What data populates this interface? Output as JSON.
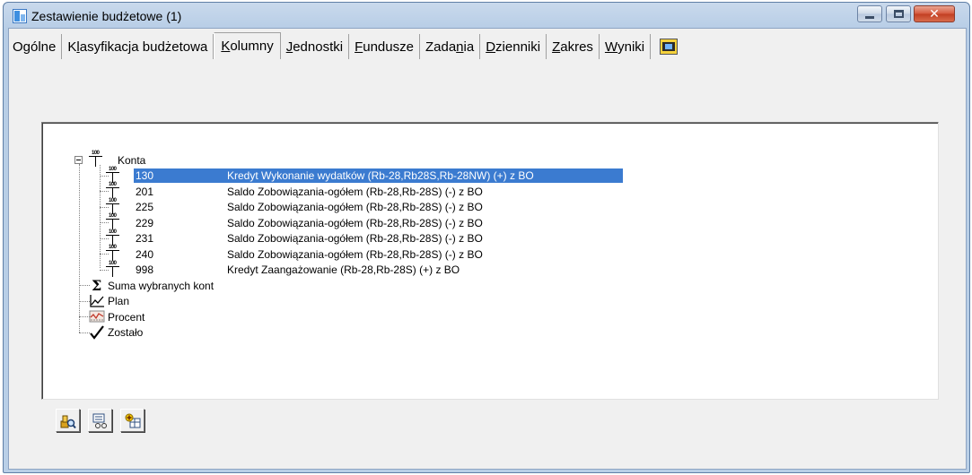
{
  "window": {
    "title": "Zestawienie budżetowe (1)",
    "close_label": "✕"
  },
  "tabs": [
    {
      "label": "Ogólne",
      "underline": ""
    },
    {
      "pre": "K",
      "u": "l",
      "post": "asyfikacja budżetowa"
    },
    {
      "pre": "",
      "u": "K",
      "post": "olumny"
    },
    {
      "pre": "",
      "u": "J",
      "post": "ednostki"
    },
    {
      "pre": "",
      "u": "F",
      "post": "undusze"
    },
    {
      "pre": "Zada",
      "u": "n",
      "post": "ia"
    },
    {
      "pre": "",
      "u": "D",
      "post": "zienniki"
    },
    {
      "pre": "",
      "u": "Z",
      "post": "akres"
    },
    {
      "pre": "",
      "u": "W",
      "post": "yniki"
    }
  ],
  "active_tab_index": 2,
  "tree": {
    "root_label": "Konta",
    "icon_number": "100",
    "accounts": [
      {
        "code": "130",
        "desc": "Kredyt Wykonanie wydatków (Rb-28,Rb28S,Rb-28NW) (+) z BO",
        "selected": true
      },
      {
        "code": "201",
        "desc": "Saldo Zobowiązania-ogółem (Rb-28,Rb-28S) (-) z BO"
      },
      {
        "code": "225",
        "desc": "Saldo Zobowiązania-ogółem (Rb-28,Rb-28S) (-) z BO"
      },
      {
        "code": "229",
        "desc": "Saldo Zobowiązania-ogółem (Rb-28,Rb-28S) (-) z BO"
      },
      {
        "code": "231",
        "desc": "Saldo Zobowiązania-ogółem (Rb-28,Rb-28S) (-) z BO"
      },
      {
        "code": "240",
        "desc": "Saldo Zobowiązania-ogółem (Rb-28,Rb-28S) (-) z BO"
      },
      {
        "code": "998",
        "desc": "Kredyt Zaangażowanie (Rb-28,Rb-28S) (+) z BO"
      }
    ],
    "extra": [
      {
        "label": "Suma wybranych kont",
        "icon": "sigma-icon"
      },
      {
        "label": "Plan",
        "icon": "plan-chart-icon"
      },
      {
        "label": "Procent",
        "icon": "percent-chart-icon"
      },
      {
        "label": "Zostało",
        "icon": "checkmark-icon"
      }
    ]
  },
  "colors": {
    "selection": "#3b7bd0",
    "client_bg": "#f0f0f0"
  }
}
